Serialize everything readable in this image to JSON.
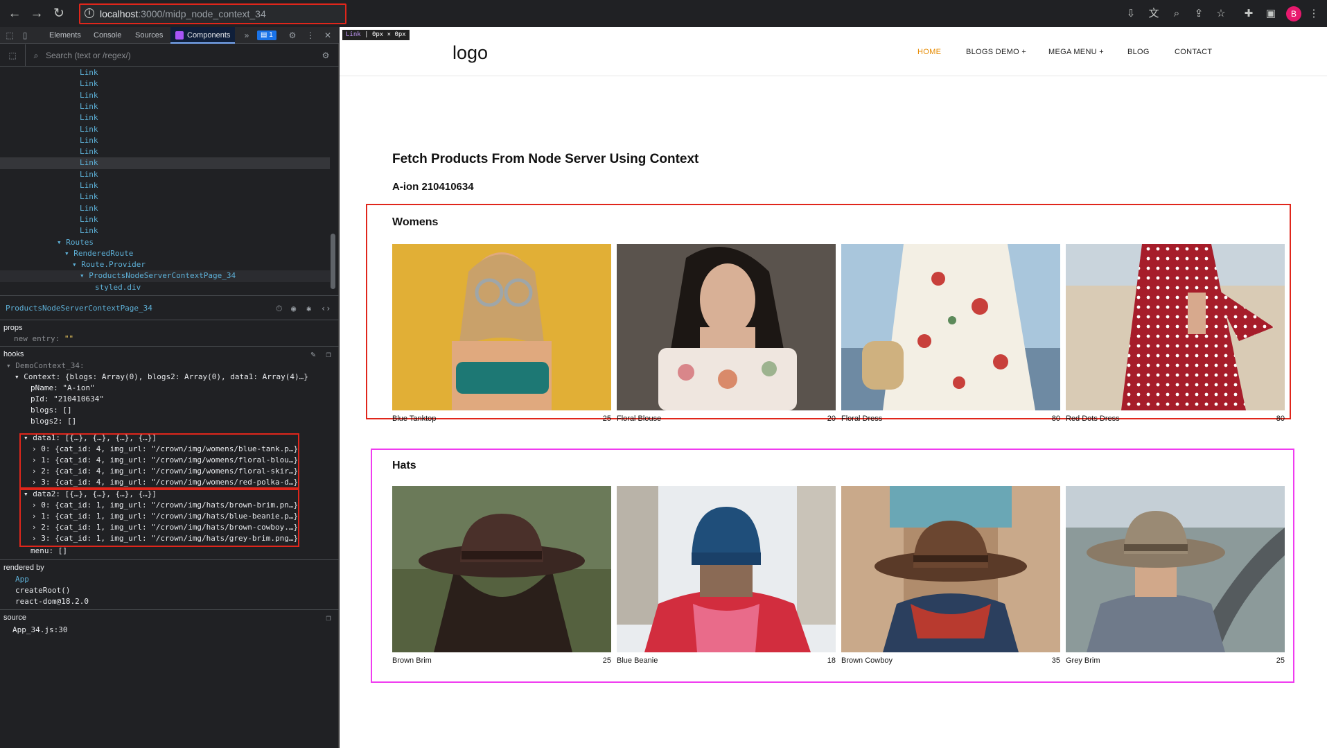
{
  "browser": {
    "url_host": "localhost",
    "url_rest": ":3000/midp_node_context_34",
    "profile_initial": "B"
  },
  "devtools": {
    "tabs": [
      "Elements",
      "Console",
      "Sources",
      "Components"
    ],
    "active_tab": "Components",
    "issues_badge": "1",
    "search_placeholder": "Search (text or /regex/)",
    "tree": [
      {
        "label": "Link",
        "indent": 0
      },
      {
        "label": "Link",
        "indent": 0
      },
      {
        "label": "Link",
        "indent": 0
      },
      {
        "label": "Link",
        "indent": 0
      },
      {
        "label": "Link",
        "indent": 0
      },
      {
        "label": "Link",
        "indent": 0
      },
      {
        "label": "Link",
        "indent": 0
      },
      {
        "label": "Link",
        "indent": 0
      },
      {
        "label": "Link",
        "indent": 0,
        "selected": true
      },
      {
        "label": "Link",
        "indent": 0
      },
      {
        "label": "Link",
        "indent": 0
      },
      {
        "label": "Link",
        "indent": 0
      },
      {
        "label": "Link",
        "indent": 0
      },
      {
        "label": "Link",
        "indent": 0
      },
      {
        "label": "Link",
        "indent": 0
      },
      {
        "label": "▾ Routes",
        "indent": 1
      },
      {
        "label": "▾ RenderedRoute",
        "indent": 2
      },
      {
        "label": "▾ Route.Provider",
        "indent": 3
      },
      {
        "label": "▾ ProductsNodeServerContextPage_34",
        "indent": 4,
        "highlight": true
      },
      {
        "label": "styled.div",
        "indent": 5
      }
    ],
    "selected_component": "ProductsNodeServerContextPage_34",
    "props_label": "props",
    "props_entry_key": "new entry:",
    "props_entry_value": "\"\"",
    "hooks_label": "hooks",
    "hooks": {
      "context_name": "▾ DemoContext_34:",
      "context_line": "▾ Context: {blogs: Array(0), blogs2: Array(0), data1: Array(4)…}",
      "pName": "pName: \"A-ion\"",
      "pId": "pId: \"210410634\"",
      "blogs": "blogs: []",
      "blogs2": "blogs2: []",
      "data1_header": "▾ data1: [{…}, {…}, {…}, {…}]",
      "data1": [
        "› 0: {cat_id: 4, img_url: \"/crown/img/womens/blue-tank.p…}",
        "› 1: {cat_id: 4, img_url: \"/crown/img/womens/floral-blou…}",
        "› 2: {cat_id: 4, img_url: \"/crown/img/womens/floral-skir…}",
        "› 3: {cat_id: 4, img_url: \"/crown/img/womens/red-polka-d…}"
      ],
      "data2_header": "▾ data2: [{…}, {…}, {…}, {…}]",
      "data2": [
        "› 0: {cat_id: 1, img_url: \"/crown/img/hats/brown-brim.pn…}",
        "› 1: {cat_id: 1, img_url: \"/crown/img/hats/blue-beanie.p…}",
        "› 2: {cat_id: 1, img_url: \"/crown/img/hats/brown-cowboy.…}",
        "› 3: {cat_id: 1, img_url: \"/crown/img/hats/grey-brim.png…}"
      ],
      "menu": "menu: []"
    },
    "rendered_by_label": "rendered by",
    "rendered_by": [
      "App",
      "createRoot()",
      "react-dom@18.2.0"
    ],
    "source_label": "source",
    "source_value": "App_34.js:30"
  },
  "page": {
    "tooltip_name": "Link",
    "tooltip_size": "0px × 0px",
    "logo": "logo",
    "nav": [
      "HOME",
      "BLOGS DEMO +",
      "MEGA MENU +",
      "BLOG",
      "CONTACT"
    ],
    "active_nav": "HOME",
    "title": "Fetch Products From Node Server Using Context",
    "subtitle": "A-ion 210410634",
    "sections": [
      {
        "title": "Womens",
        "border_color": "#e0261b",
        "products": [
          {
            "name": "Blue Tanktop",
            "price": "25"
          },
          {
            "name": "Floral Blouse",
            "price": "20"
          },
          {
            "name": "Floral Dress",
            "price": "80"
          },
          {
            "name": "Red Dots Dress",
            "price": "80"
          }
        ]
      },
      {
        "title": "Hats",
        "border_color": "#f03cf0",
        "products": [
          {
            "name": "Brown Brim",
            "price": "25"
          },
          {
            "name": "Blue Beanie",
            "price": "18"
          },
          {
            "name": "Brown Cowboy",
            "price": "35"
          },
          {
            "name": "Grey Brim",
            "price": "25"
          }
        ]
      }
    ]
  }
}
